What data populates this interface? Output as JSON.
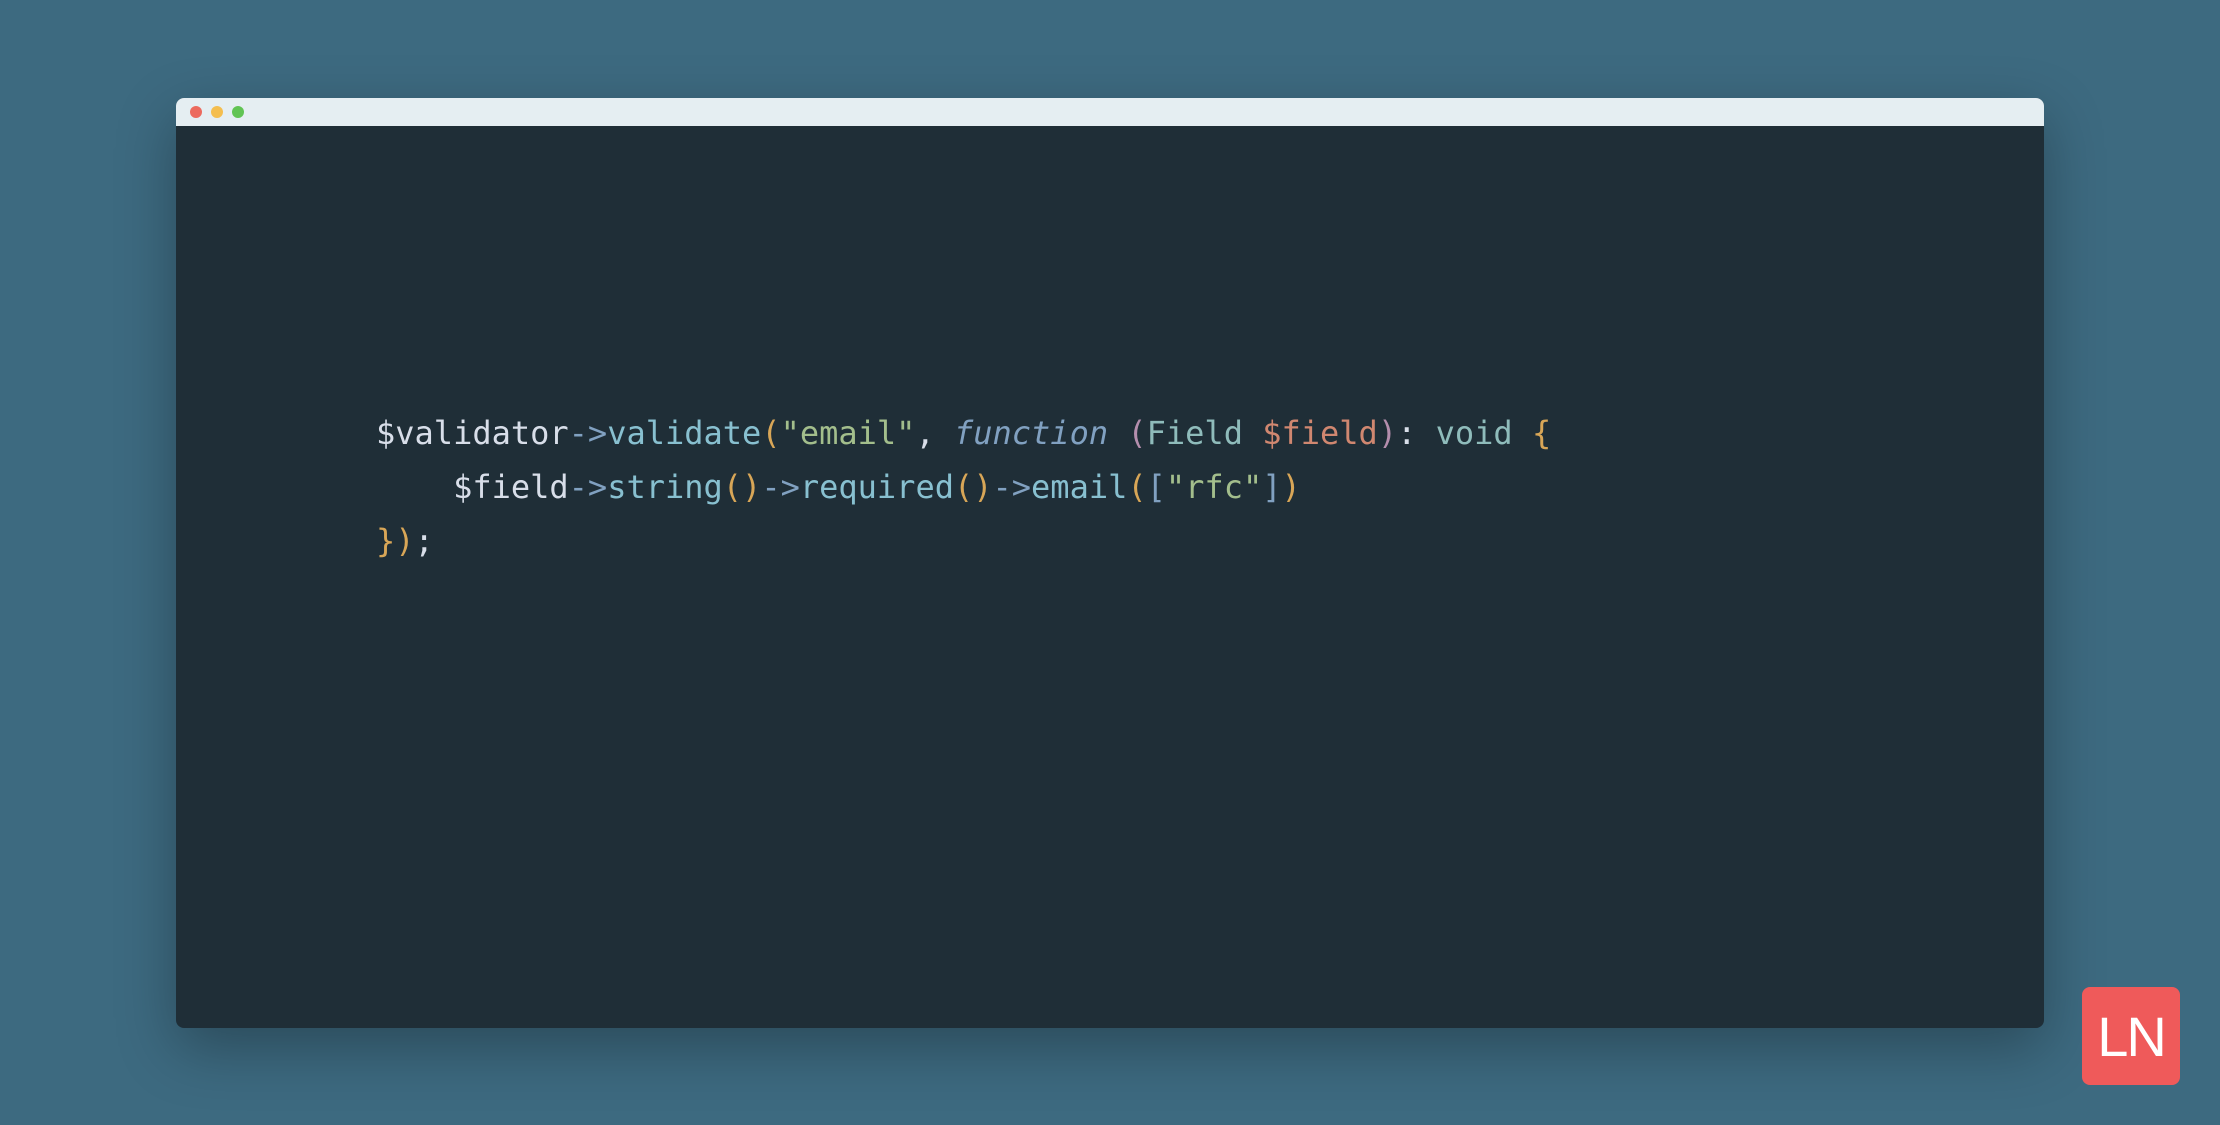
{
  "logo": {
    "text": "LN"
  },
  "code": {
    "line1": {
      "t1": "$validator",
      "t2": "->",
      "t3": "validate",
      "t4": "(",
      "t5": "\"email\"",
      "t6": ", ",
      "t7": "function",
      "t8": " ",
      "t9": "(",
      "t10": "Field ",
      "t11": "$field",
      "t12": ")",
      "t13": ": ",
      "t14": "void",
      "t15": " ",
      "t16": "{"
    },
    "line2": {
      "indent": "    ",
      "t1": "$field",
      "t2": "->",
      "t3": "string",
      "t4": "()",
      "t5": "->",
      "t6": "required",
      "t7": "()",
      "t8": "->",
      "t9": "email",
      "t10": "(",
      "t11": "[",
      "t12": "\"rfc\"",
      "t13": "]",
      "t14": ")"
    },
    "line3": {
      "t1": "}",
      "t2": ")",
      "t3": ";"
    }
  }
}
